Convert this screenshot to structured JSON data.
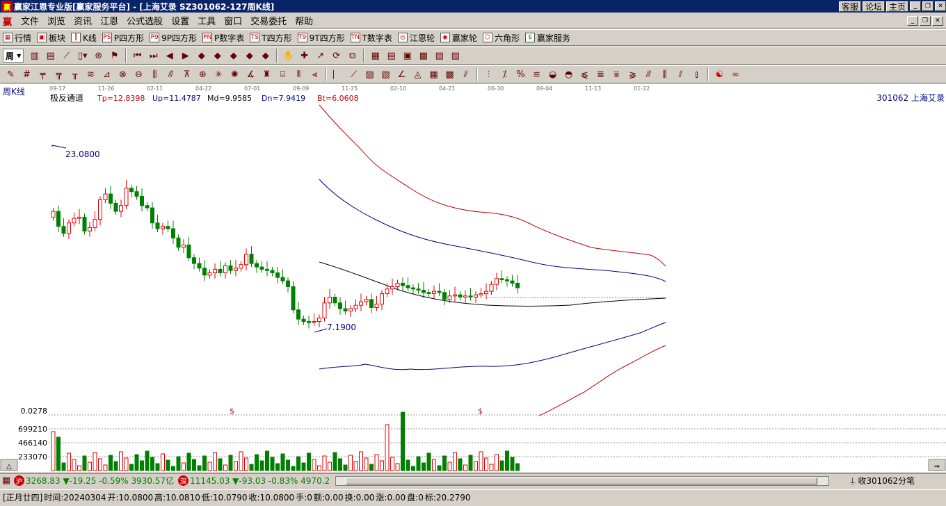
{
  "window": {
    "title": "赢家江恩专业版[赢家服务平台] - [上海艾录  SZ301062-127周K线]",
    "links": [
      "客服",
      "论坛",
      "主页"
    ]
  },
  "menu": {
    "items": [
      "文件",
      "浏览",
      "资讯",
      "江恩",
      "公式选股",
      "设置",
      "工具",
      "窗口",
      "交易委托",
      "帮助"
    ]
  },
  "toolbar1": {
    "items": [
      {
        "label": "行情",
        "icon": "grid-icon"
      },
      {
        "label": "板块",
        "icon": "blocks-icon"
      },
      {
        "label": "K线",
        "icon": "candle-icon"
      },
      {
        "label": "P四方形",
        "icon": "p4-icon",
        "tag": "PS"
      },
      {
        "label": "9P四方形",
        "icon": "p9-icon",
        "tag": "P9"
      },
      {
        "label": "P数字表",
        "icon": "pn-icon",
        "tag": "PN"
      },
      {
        "label": "T四方形",
        "icon": "ts-icon",
        "tag": "TS"
      },
      {
        "label": "9T四方形",
        "icon": "t9-icon",
        "tag": "T9"
      },
      {
        "label": "T数字表",
        "icon": "tn-icon",
        "tag": "TN"
      },
      {
        "label": "江恩轮",
        "icon": "gann-wheel-icon"
      },
      {
        "label": "赢家轮",
        "icon": "winner-wheel-icon"
      },
      {
        "label": "六角形",
        "icon": "hexagon-icon"
      },
      {
        "label": "赢家服务",
        "icon": "dollar-icon"
      }
    ]
  },
  "toolbar2": {
    "period": "周"
  },
  "chart": {
    "period_label": "周K线",
    "indicator_name": "极反通道",
    "tp": "Tp=12.8398",
    "up": "Up=11.4787",
    "md": "Md=9.9585",
    "dn": "Dn=7.9419",
    "bt": "Bt=6.0608",
    "stock": "301062 上海艾录",
    "high_label": "23.0800",
    "low_label": "7.1900",
    "date_ticks": [
      "09-17",
      "11-26",
      "02-11",
      "04-22",
      "07-01",
      "09-09",
      "11-25",
      "02-10",
      "04-21",
      "06-30",
      "09-04",
      "11-13",
      "01-22"
    ],
    "vol_labels": [
      "0.0278",
      "699210",
      "466140",
      "233070"
    ],
    "dollar_marks": [
      "$",
      "$"
    ],
    "colors": {
      "up": "#e00000",
      "down": "#008000",
      "tp": "#c00000",
      "up_line": "#000080",
      "md": "#000000"
    }
  },
  "status1": {
    "sh_badge": "沪",
    "sh_text": "3268.83",
    "sh_change": "▼-19.25 -0.59% 3930.57亿",
    "sz_badge": "深",
    "sz_text": "11145.03",
    "sz_change": "▼-93.03 -0.83% 4970.2",
    "right": "收301062分笔"
  },
  "status2": {
    "lunar": "[正月廿四]",
    "time": "时间:20240304",
    "open": "开:10.0800",
    "high": "高:10.0810",
    "low": "低:10.0790",
    "close": "收:10.0800",
    "hand": "手:0",
    "amount": "额:0.00",
    "turnover": "换:0.00",
    "rise": "涨:0.00",
    "pan": "盘:0",
    "mark": "标:20.2790"
  }
}
